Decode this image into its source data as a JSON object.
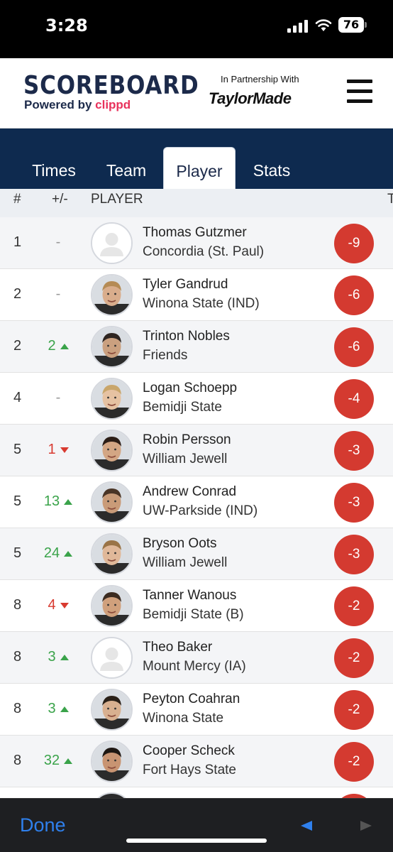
{
  "status": {
    "time": "3:28",
    "battery": "76"
  },
  "header": {
    "brand": "SCOREBOARD",
    "powered_prefix": "Powered by ",
    "powered_brand": "clippd",
    "partner_text": "In Partnership With",
    "partner_brand": "TaylorMade"
  },
  "tabs": [
    {
      "label": "Times",
      "active": false
    },
    {
      "label": "Team",
      "active": false
    },
    {
      "label": "Player",
      "active": true
    },
    {
      "label": "Stats",
      "active": false
    }
  ],
  "columns": {
    "rank": "#",
    "move": "+/-",
    "player": "PLAYER",
    "total": "T"
  },
  "players": [
    {
      "rank": "1",
      "move": "-",
      "dir": "none",
      "name": "Thomas Gutzmer",
      "team": "Concordia (St. Paul)",
      "score": "-9",
      "photo": false
    },
    {
      "rank": "2",
      "move": "-",
      "dir": "none",
      "name": "Tyler Gandrud",
      "team": "Winona State (IND)",
      "score": "-6",
      "photo": true
    },
    {
      "rank": "2",
      "move": "2",
      "dir": "up",
      "name": "Trinton Nobles",
      "team": "Friends",
      "score": "-6",
      "photo": true
    },
    {
      "rank": "4",
      "move": "-",
      "dir": "none",
      "name": "Logan Schoepp",
      "team": "Bemidji State",
      "score": "-4",
      "photo": true
    },
    {
      "rank": "5",
      "move": "1",
      "dir": "down",
      "name": "Robin Persson",
      "team": "William Jewell",
      "score": "-3",
      "photo": true
    },
    {
      "rank": "5",
      "move": "13",
      "dir": "up",
      "name": "Andrew Conrad",
      "team": "UW-Parkside (IND)",
      "score": "-3",
      "photo": true
    },
    {
      "rank": "5",
      "move": "24",
      "dir": "up",
      "name": "Bryson Oots",
      "team": "William Jewell",
      "score": "-3",
      "photo": true
    },
    {
      "rank": "8",
      "move": "4",
      "dir": "down",
      "name": "Tanner Wanous",
      "team": "Bemidji State (B)",
      "score": "-2",
      "photo": true
    },
    {
      "rank": "8",
      "move": "3",
      "dir": "up",
      "name": "Theo Baker",
      "team": "Mount Mercy (IA)",
      "score": "-2",
      "photo": false
    },
    {
      "rank": "8",
      "move": "3",
      "dir": "up",
      "name": "Peyton Coahran",
      "team": "Winona State",
      "score": "-2",
      "photo": true
    },
    {
      "rank": "8",
      "move": "32",
      "dir": "up",
      "name": "Cooper Scheck",
      "team": "Fort Hays State",
      "score": "-2",
      "photo": true
    }
  ],
  "bottom": {
    "done_label": "Done"
  },
  "colors": {
    "navy": "#0e2a4f",
    "score_red": "#d43a30",
    "up_green": "#3aa34a",
    "down_red": "#d83a30",
    "link_blue": "#2f80ed"
  }
}
